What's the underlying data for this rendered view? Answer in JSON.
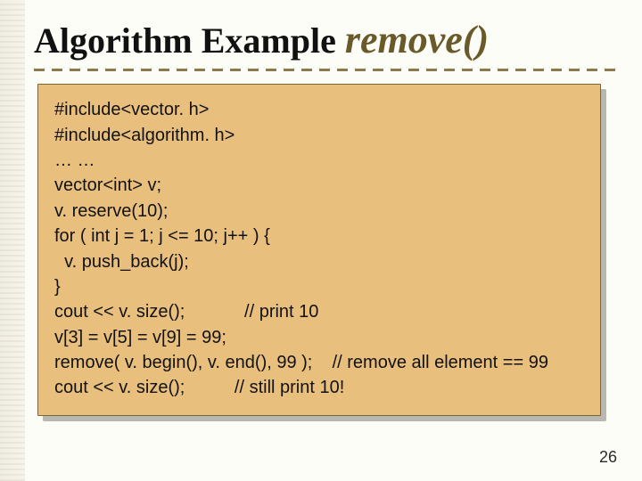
{
  "title_prefix": "Algorithm Example ",
  "title_func": "remove()",
  "code_lines": [
    "#include<vector. h>",
    "#include<algorithm. h>",
    "… …",
    "vector<int> v;",
    "v. reserve(10);",
    "for ( int j = 1; j <= 10; j++ ) {",
    "  v. push_back(j);",
    "}",
    "cout << v. size();            // print 10",
    "v[3] = v[5] = v[9] = 99;",
    "remove( v. begin(), v. end(), 99 );    // remove all element == 99",
    "cout << v. size();          // still print 10!"
  ],
  "page_number": "26"
}
